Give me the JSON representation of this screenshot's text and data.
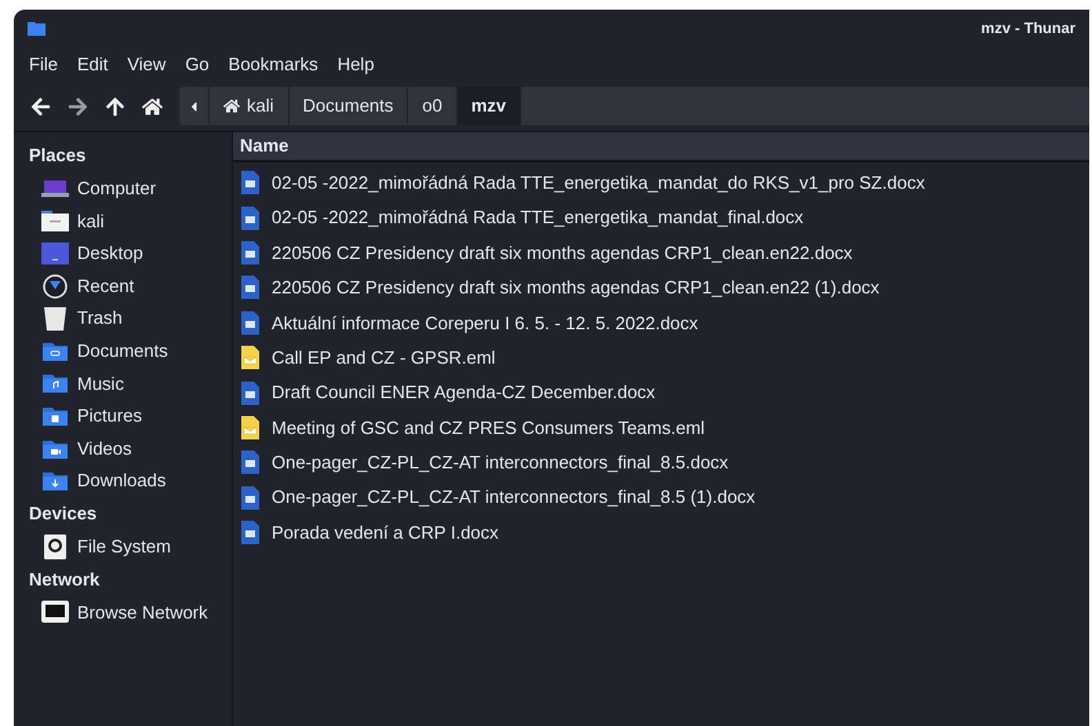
{
  "window": {
    "title": "mzv - Thunar"
  },
  "menu": [
    "File",
    "Edit",
    "View",
    "Go",
    "Bookmarks",
    "Help"
  ],
  "path": [
    {
      "label": "kali",
      "kind": "home",
      "selected": false
    },
    {
      "label": "Documents",
      "kind": "folder",
      "selected": false
    },
    {
      "label": "o0",
      "kind": "folder",
      "selected": false
    },
    {
      "label": "mzv",
      "kind": "folder",
      "selected": true
    }
  ],
  "sidebar": [
    {
      "heading": "Places",
      "items": [
        {
          "label": "Computer",
          "kind": "computer"
        },
        {
          "label": "kali",
          "kind": "home"
        },
        {
          "label": "Desktop",
          "kind": "desktop"
        },
        {
          "label": "Recent",
          "kind": "recent"
        },
        {
          "label": "Trash",
          "kind": "trash"
        },
        {
          "label": "Documents",
          "kind": "documents"
        },
        {
          "label": "Music",
          "kind": "music"
        },
        {
          "label": "Pictures",
          "kind": "pictures"
        },
        {
          "label": "Videos",
          "kind": "videos"
        },
        {
          "label": "Downloads",
          "kind": "downloads"
        }
      ]
    },
    {
      "heading": "Devices",
      "items": [
        {
          "label": "File System",
          "kind": "drive"
        }
      ]
    },
    {
      "heading": "Network",
      "items": [
        {
          "label": "Browse Network",
          "kind": "network"
        }
      ]
    }
  ],
  "table": {
    "columns": [
      "Name"
    ],
    "rows": [
      {
        "name": "02-05 -2022_mimořádná Rada TTE_energetika_mandat_do RKS_v1_pro SZ.docx",
        "kind": "docx"
      },
      {
        "name": "02-05 -2022_mimořádná Rada TTE_energetika_mandat_final.docx",
        "kind": "docx"
      },
      {
        "name": "220506 CZ Presidency draft six months agendas CRP1_clean.en22.docx",
        "kind": "docx"
      },
      {
        "name": "220506 CZ Presidency draft six months agendas CRP1_clean.en22 (1).docx",
        "kind": "docx"
      },
      {
        "name": "Aktuální informace Coreperu I 6. 5. - 12. 5. 2022.docx",
        "kind": "docx"
      },
      {
        "name": "Call EP and CZ - GPSR.eml",
        "kind": "eml"
      },
      {
        "name": "Draft Council ENER Agenda-CZ December.docx",
        "kind": "docx"
      },
      {
        "name": "Meeting of GSC and CZ PRES Consumers Teams.eml",
        "kind": "eml"
      },
      {
        "name": "One-pager_CZ-PL_CZ-AT interconnectors_final_8.5.docx",
        "kind": "docx"
      },
      {
        "name": "One-pager_CZ-PL_CZ-AT interconnectors_final_8.5 (1).docx",
        "kind": "docx"
      },
      {
        "name": "Porada vedení a CRP I.docx",
        "kind": "docx"
      }
    ]
  }
}
